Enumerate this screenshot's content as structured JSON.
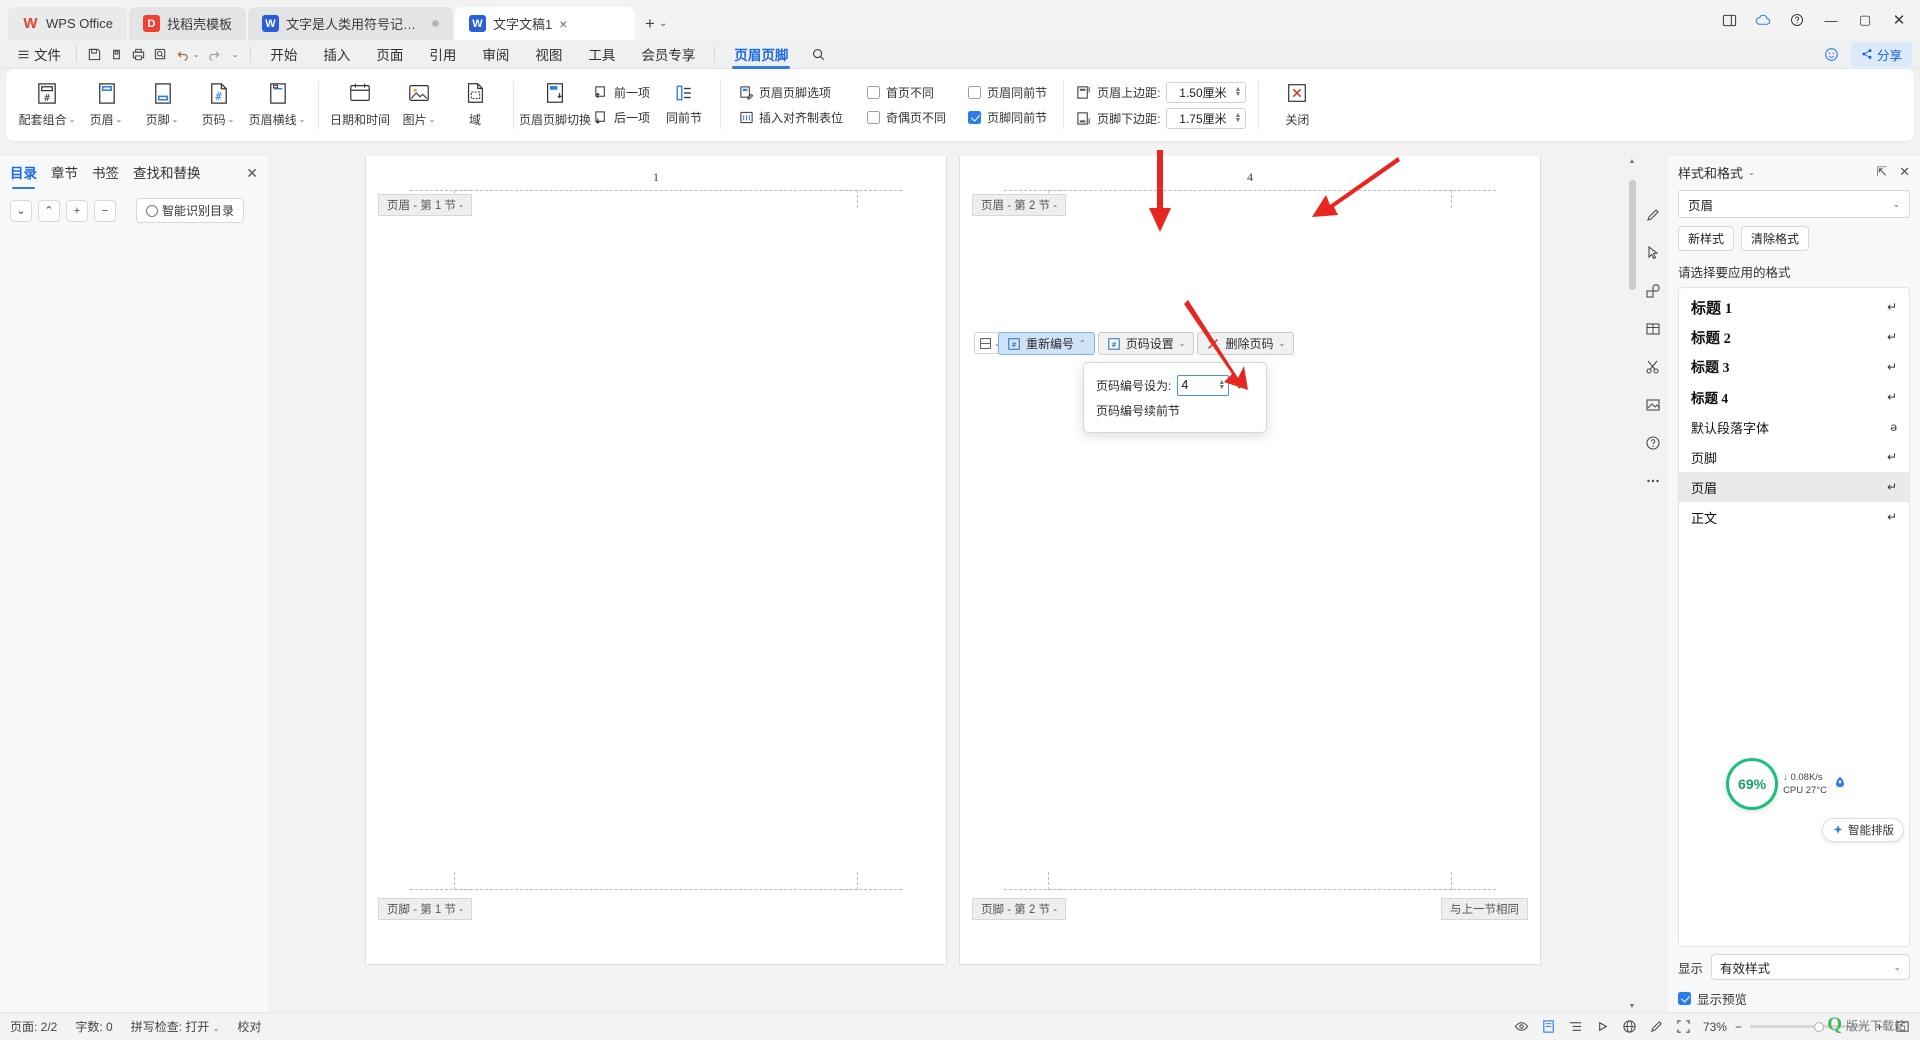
{
  "titlebar": {
    "tabs": [
      {
        "label": "WPS Office",
        "icon": "wps-logo-icon",
        "type": "wps"
      },
      {
        "label": "找稻壳模板",
        "icon": "docer-icon",
        "type": "red"
      },
      {
        "label": "文字是人类用符号记录表达信息以",
        "icon": "word-doc-icon",
        "type": "blue"
      },
      {
        "label": "文字文稿1",
        "icon": "word-doc-icon",
        "type": "blue"
      }
    ],
    "new_tab": "+",
    "window_buttons": [
      "layout-icon",
      "cloud-sync-icon",
      "help-icon",
      "minimize",
      "maximize",
      "close"
    ]
  },
  "menubar": {
    "file_menu": "文件",
    "quick_icons": [
      "save-icon",
      "print-preview-icon",
      "print-icon",
      "find-icon",
      "undo-icon",
      "redo-icon",
      "customize-icon"
    ],
    "tabs": [
      {
        "label": "开始",
        "active": false
      },
      {
        "label": "插入",
        "active": false
      },
      {
        "label": "页面",
        "active": false
      },
      {
        "label": "引用",
        "active": false
      },
      {
        "label": "审阅",
        "active": false
      },
      {
        "label": "视图",
        "active": false
      },
      {
        "label": "工具",
        "active": false
      },
      {
        "label": "会员专享",
        "active": false
      },
      {
        "label": "页眉页脚",
        "active": true
      }
    ],
    "search_icon": "search-icon",
    "smile_icon": "smile-icon",
    "share_label": "分享",
    "share_icon": "share-icon"
  },
  "ribbon": {
    "big_buttons": [
      {
        "label": "配套组合",
        "icon": "header-footer-combo-icon",
        "caret": true
      },
      {
        "label": "页眉",
        "icon": "header-icon",
        "caret": true
      },
      {
        "label": "页脚",
        "icon": "footer-icon",
        "caret": true
      },
      {
        "label": "页码",
        "icon": "page-number-icon",
        "caret": true
      },
      {
        "label": "页眉横线",
        "icon": "header-line-icon",
        "caret": true
      }
    ],
    "group2": [
      {
        "label": "日期和时间",
        "icon": "date-time-icon"
      },
      {
        "label": "图片",
        "icon": "picture-icon",
        "caret": true
      },
      {
        "label": "域",
        "icon": "field-icon"
      }
    ],
    "group3": {
      "big": {
        "label": "页眉页脚切换",
        "icon": "switch-header-footer-icon"
      },
      "items": [
        {
          "label": "前一项",
          "icon": "previous-item-icon"
        },
        {
          "label": "后一项",
          "icon": "next-item-icon"
        },
        {
          "label": "同前节",
          "icon": "same-as-previous-icon"
        }
      ]
    },
    "group4": [
      {
        "label": "页眉页脚选项",
        "icon": "header-footer-options-icon"
      },
      {
        "label": "插入对齐制表位",
        "icon": "insert-alignment-tab-icon"
      }
    ],
    "checkboxes": [
      {
        "label": "首页不同",
        "checked": false
      },
      {
        "label": "奇偶页不同",
        "checked": false
      },
      {
        "label": "页眉同前节",
        "checked": false
      },
      {
        "label": "页脚同前节",
        "checked": true
      }
    ],
    "margins": [
      {
        "label": "页眉上边距:",
        "value": "1.50厘米",
        "icon": "header-top-margin-icon"
      },
      {
        "label": "页脚下边距:",
        "value": "1.75厘米",
        "icon": "footer-bottom-margin-icon"
      }
    ],
    "close": {
      "label": "关闭",
      "icon": "close-x-icon"
    }
  },
  "leftpane": {
    "tabs": [
      {
        "label": "目录",
        "active": true
      },
      {
        "label": "章节",
        "active": false
      },
      {
        "label": "书签",
        "active": false
      },
      {
        "label": "查找和替换",
        "active": false
      }
    ],
    "close_icon": "close-icon",
    "tools": [
      {
        "icon": "chevron-down-icon",
        "label": "⌄"
      },
      {
        "icon": "chevron-up-icon",
        "label": "⌃"
      },
      {
        "icon": "plus-icon",
        "label": "+"
      },
      {
        "icon": "minus-icon",
        "label": "−"
      }
    ],
    "ai_button": {
      "label": "智能识别目录",
      "icon": "ai-ring-icon"
    }
  },
  "document": {
    "page1": {
      "page_number": "1",
      "header_tag": "页眉  - 第 1 节 -",
      "footer_tag": "页脚  - 第 1 节 -"
    },
    "page2": {
      "page_number": "4",
      "header_tag": "页眉  - 第 2 节 -",
      "footer_tag": "页脚  - 第 2 节 -",
      "same_as_previous_tag": "与上一节相同"
    },
    "header_toolbar": [
      {
        "label": "重新编号",
        "icon": "renumber-icon",
        "selected": true,
        "caret": true
      },
      {
        "label": "页码设置",
        "icon": "page-number-settings-icon",
        "selected": false,
        "caret": true
      },
      {
        "label": "删除页码",
        "icon": "delete-page-number-icon",
        "selected": false,
        "caret": true
      }
    ],
    "popup": {
      "set_label": "页码编号设为:",
      "value": "4",
      "confirm_icon": "check-icon",
      "continue_label": "页码编号续前节"
    }
  },
  "rightrail": {
    "icons": [
      "pen-edit-icon",
      "cursor-select-icon",
      "shapes-icon",
      "table-icon",
      "scissors-icon",
      "image-frame-icon",
      "help-circle-icon",
      "more-dots-icon"
    ]
  },
  "stylepanel": {
    "title": "样式和格式",
    "title_caret": "⌄",
    "pin_icon": "pin-icon",
    "close_icon": "close-icon",
    "current_style": "页眉",
    "buttons": [
      {
        "label": "新样式"
      },
      {
        "label": "清除格式"
      }
    ],
    "list_label": "请选择要应用的格式",
    "styles": [
      {
        "name": "标题  1",
        "mark": "↵",
        "level": "h1",
        "selected": false
      },
      {
        "name": "标题  2",
        "mark": "↵",
        "level": "h2",
        "selected": false
      },
      {
        "name": "标题  3",
        "mark": "↵",
        "level": "h3",
        "selected": false
      },
      {
        "name": "标题  4",
        "mark": "↵",
        "level": "h4",
        "selected": false
      },
      {
        "name": "默认段落字体",
        "mark": "ə",
        "level": "normal",
        "selected": false
      },
      {
        "name": "页脚",
        "mark": "↵",
        "level": "normal",
        "selected": false
      },
      {
        "name": "页眉",
        "mark": "↵",
        "level": "normal",
        "selected": true
      },
      {
        "name": "正文",
        "mark": "↵",
        "level": "normal",
        "selected": false
      }
    ],
    "show_label": "显示",
    "show_value": "有效样式",
    "preview_label": "显示预览",
    "preview_checked": true
  },
  "floating": {
    "cpu_percent": "69%",
    "net_speed": "0.08K/s",
    "cpu_temp": "CPU 27°C",
    "ai_pill": "智能排版",
    "watermark_mark": "Q",
    "watermark_text": "版光下载站"
  },
  "statusbar": {
    "page_info": "页面: 2/2",
    "word_count": "字数: 0",
    "spellcheck": "拼写检查: 打开",
    "proof": "校对",
    "right_icons": [
      "eye-icon",
      "page-view-icon",
      "outline-view-icon",
      "reading-view-icon",
      "web-view-icon",
      "pen-icon",
      "focus-icon"
    ],
    "zoom_level": "73%",
    "zoom_out": "−",
    "zoom_in": "+",
    "fullscreen_icon": "fullscreen-icon"
  },
  "colors": {
    "accent": "#2b7de9",
    "ribbon_bg": "#ffffff",
    "selected_blue": "#cfe2f8",
    "arrow_red": "#e8251e",
    "green": "#18c07a"
  }
}
